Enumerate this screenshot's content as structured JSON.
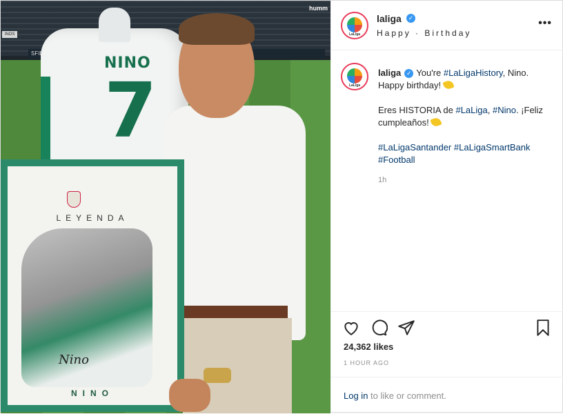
{
  "post": {
    "username": "laliga",
    "location": "Happy · Birthday",
    "more_label": "•••",
    "avatar_label": "LaLiga",
    "caption": {
      "line1_pre": "You're ",
      "tag1": "#LaLigaHistory",
      "line1_post": ", Nino. Happy birthday!",
      "line2_pre": "Eres HISTORIA de ",
      "tag2": "#LaLiga",
      "line2_mid": ", ",
      "tag3": "#Nino",
      "line2_post": ". ¡Feliz cumpleaños!",
      "tag4": "#LaLigaSantander",
      "tag5": "#LaLigaSmartBank",
      "tag6": "#Football"
    },
    "relative_time": "1h",
    "likes": "24,362 likes",
    "posted_ago": "1 HOUR AGO",
    "comment": {
      "login_label": "Log in",
      "rest": " to like or comment."
    }
  },
  "photo": {
    "jersey_name": "NINO",
    "jersey_number": "7",
    "frame_title": "LEYENDA",
    "frame_name": "NINO",
    "frame_signature": "Nino",
    "sponsor": "humm",
    "stand_sign": "INOS",
    "board_text": "SFIDA"
  },
  "colors": {
    "link": "#00376b",
    "verified": "#3897f0",
    "muted": "#8e8e8e",
    "jersey_green": "#17704d"
  },
  "icons": [
    "heart-icon",
    "comment-icon",
    "share-icon",
    "bookmark-icon",
    "party-popper-icon",
    "verified-badge-icon"
  ]
}
